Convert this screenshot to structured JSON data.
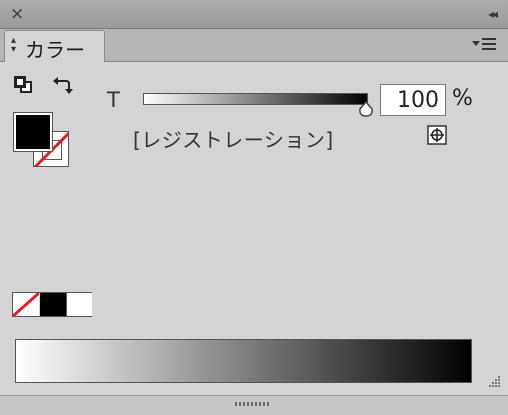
{
  "titlebar": {
    "close_icon": "×",
    "collapse_icon": "◂◂"
  },
  "tab": {
    "arrows": "⌃⌄",
    "label": "カラー"
  },
  "tint": {
    "label": "T",
    "value": "100",
    "unit": "%",
    "level": 1.0
  },
  "swatch": {
    "name": "[レジストレーション]"
  },
  "colors": {
    "fill": "#000000",
    "stroke": "#ffffff",
    "none_slash": "#e02020",
    "panel_bg": "#d6d3d6"
  },
  "icons": [
    "close-icon",
    "collapse-icon",
    "panel-menu-icon",
    "default-colors-icon",
    "swap-colors-icon",
    "registration-icon",
    "resize-grip-icon"
  ]
}
